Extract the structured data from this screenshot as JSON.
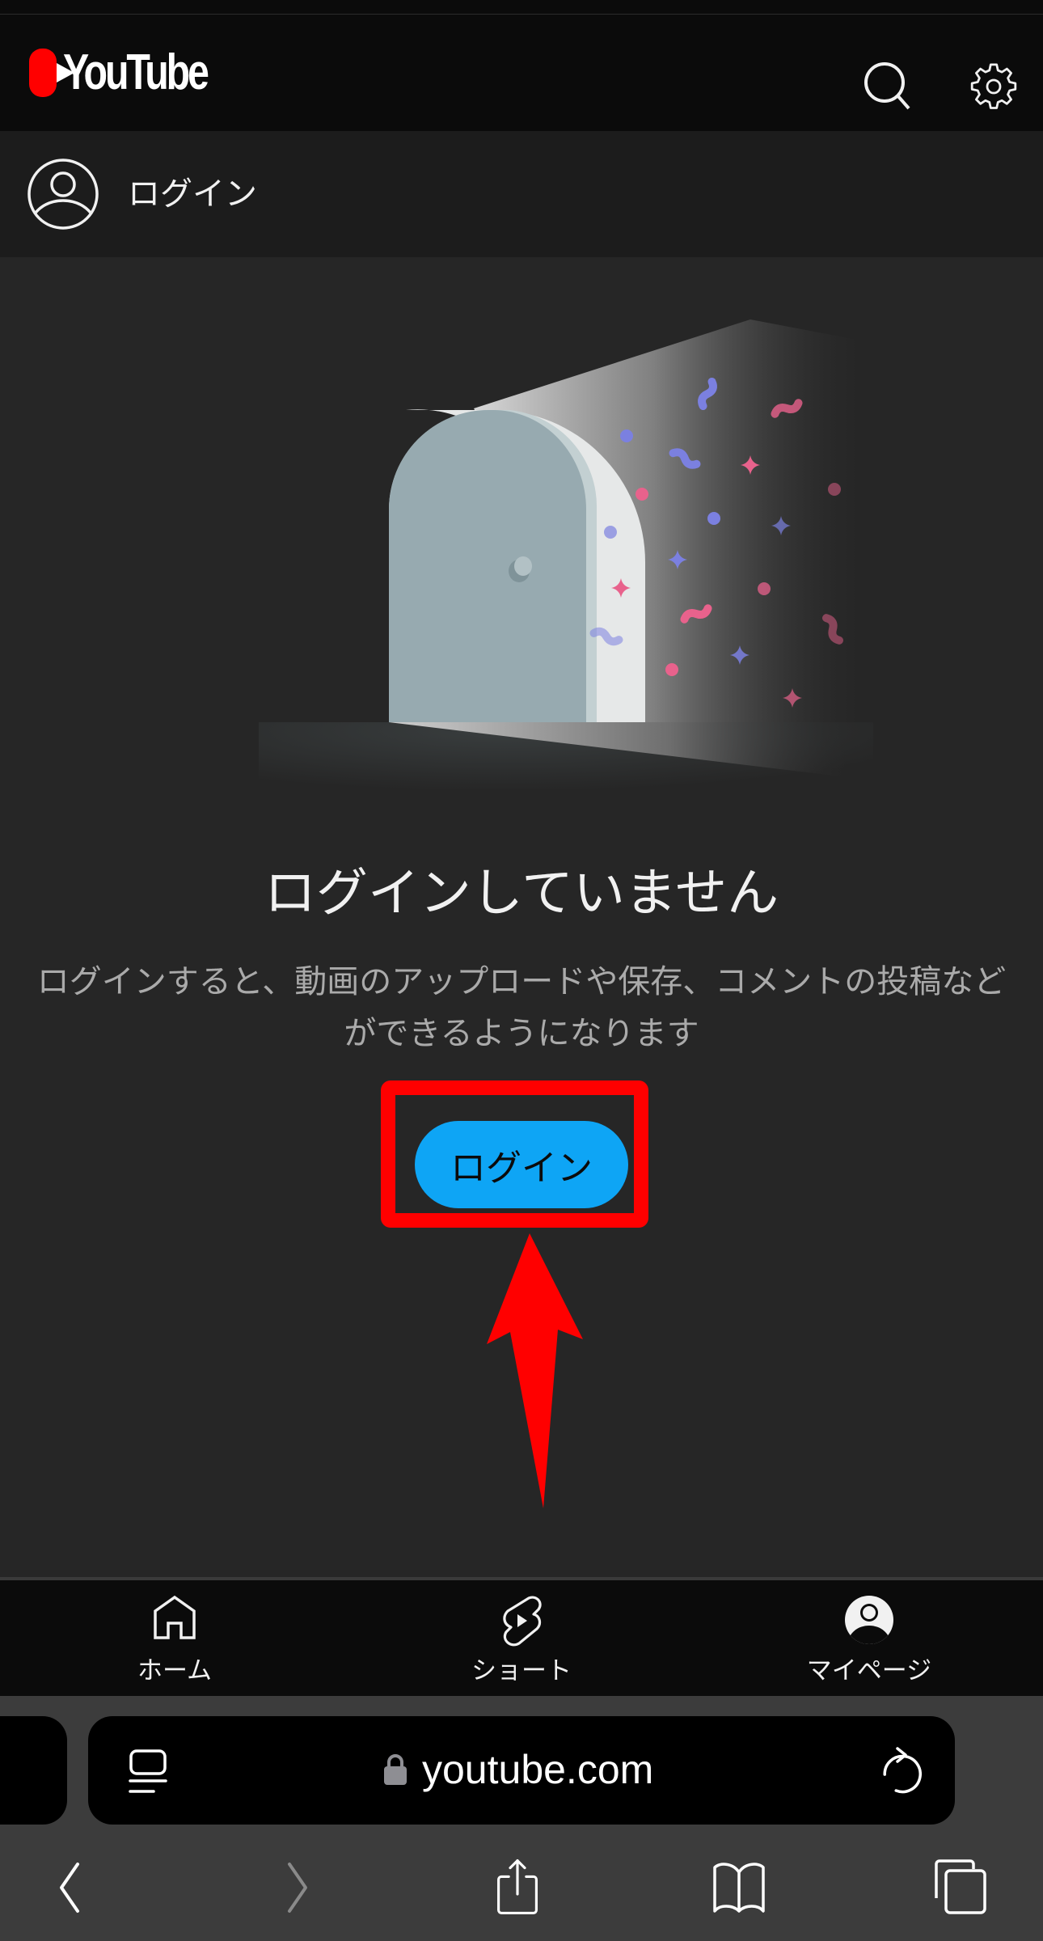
{
  "header": {
    "logo_text": "YouTube",
    "icons": [
      "search-icon",
      "settings-gear-icon"
    ]
  },
  "account_row": {
    "icon": "account-circle-icon",
    "label": "ログイン"
  },
  "main": {
    "illustration": "door-with-confetti",
    "title": "ログインしていません",
    "description": "ログインすると、動画のアップロードや保存、コメントの投稿などができるようになります",
    "login_button_label": "ログイン",
    "annotation": {
      "highlight_color": "#ff0000",
      "arrow_color": "#ff0000"
    },
    "accent_color": "#0ea5f5"
  },
  "bottom_nav": {
    "items": [
      {
        "label": "ホーム",
        "icon": "home-icon"
      },
      {
        "label": "ショート",
        "icon": "shorts-icon"
      },
      {
        "label": "マイページ",
        "icon": "account-filled-icon"
      }
    ]
  },
  "browser": {
    "url": "youtube.com",
    "icons": [
      "reader-icon",
      "lock-icon",
      "reload-icon",
      "back-icon",
      "forward-icon",
      "share-icon",
      "bookmarks-icon",
      "tabs-icon"
    ]
  },
  "confetti_colors": {
    "blue": "#7b80e0",
    "pink": "#e8628c"
  }
}
